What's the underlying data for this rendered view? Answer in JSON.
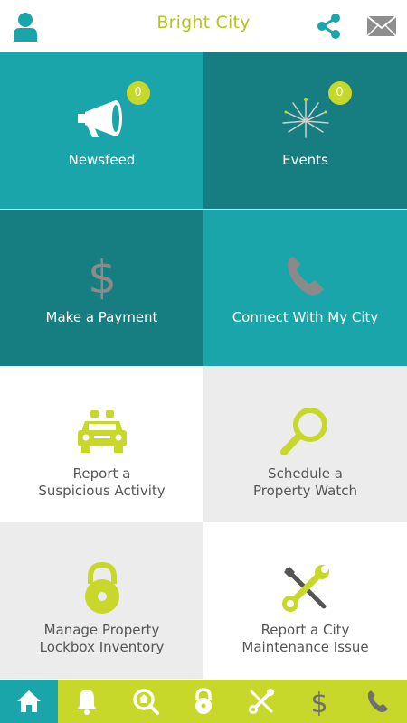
{
  "header": {
    "title": "Bright City",
    "profile_icon": "user-icon",
    "share_icon": "share-icon",
    "mail_icon": "envelope-icon"
  },
  "colors": {
    "accent": "#c8d82a",
    "teal_light": "#1aa5ab",
    "teal_dark": "#167e80",
    "title": "#b5c418"
  },
  "tiles": [
    {
      "label": "Newsfeed",
      "icon": "megaphone-icon",
      "badge": "0"
    },
    {
      "label": "Events",
      "icon": "fireworks-icon",
      "badge": "0"
    },
    {
      "label": "Make a Payment",
      "icon": "dollar-icon"
    },
    {
      "label": "Connect With My City",
      "icon": "phone-icon"
    },
    {
      "label_line1": "Report a",
      "label_line2": "Suspicious Activity",
      "icon": "police-car-icon"
    },
    {
      "label_line1": "Schedule a",
      "label_line2": "Property Watch",
      "icon": "magnifier-icon"
    },
    {
      "label_line1": "Manage Property",
      "label_line2": "Lockbox Inventory",
      "icon": "padlock-icon"
    },
    {
      "label_line1": "Report a City",
      "label_line2": "Maintenance Issue",
      "icon": "tools-icon"
    }
  ],
  "tabbar": {
    "active": "home",
    "items": [
      "home-icon",
      "bell-icon",
      "search-home-icon",
      "lock-icon",
      "tools-icon",
      "dollar-icon",
      "phone-icon"
    ]
  }
}
